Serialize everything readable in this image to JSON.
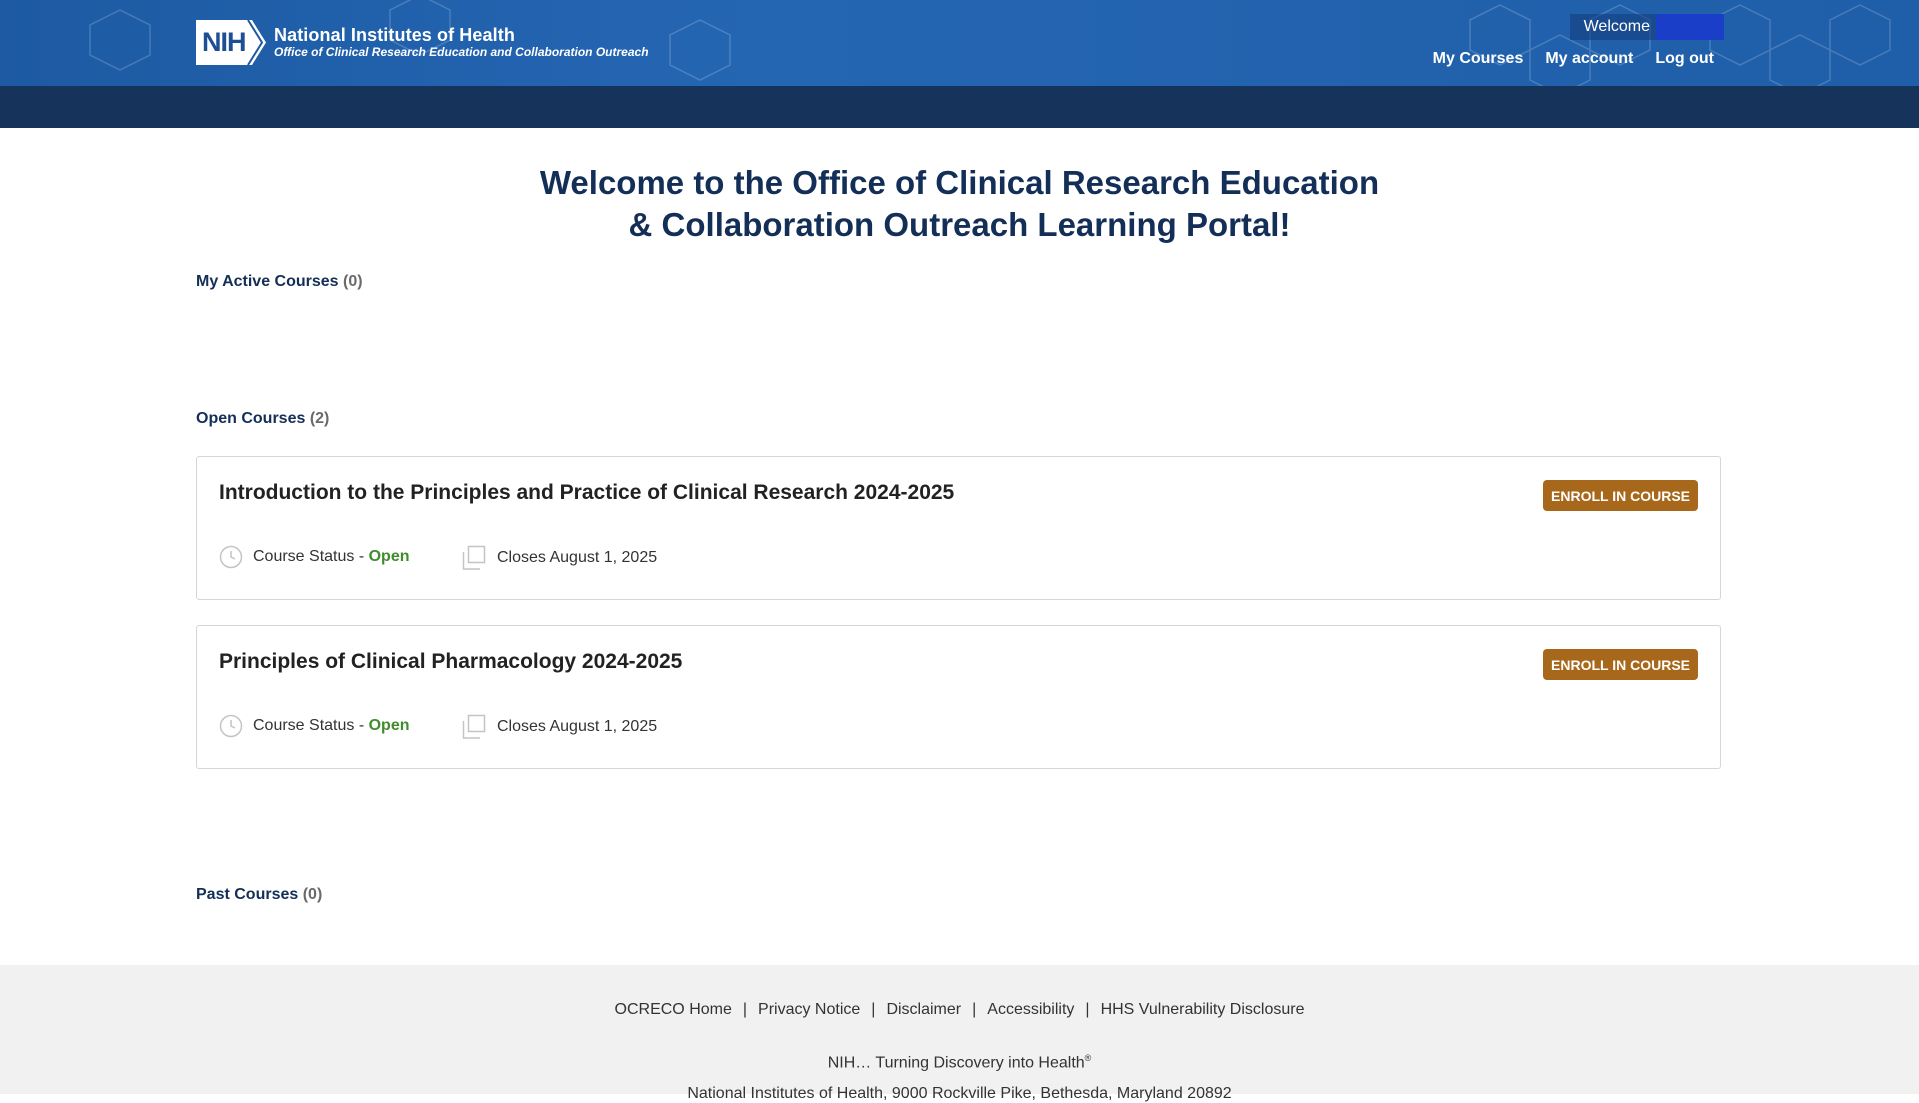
{
  "header": {
    "logo_abbr": "NIH",
    "logo_title": "National Institutes of Health",
    "logo_subtitle": "Office of Clinical Research Education and Collaboration Outreach",
    "welcome_label": "Welcome",
    "nav": [
      "My Courses",
      "My account",
      "Log out"
    ]
  },
  "main": {
    "title_line1": "Welcome to the Office of Clinical Research Education",
    "title_line2": "& Collaboration Outreach Learning Portal!",
    "active_label": "My Active Courses",
    "active_count": "(0)",
    "open_label": "Open Courses",
    "open_count": "(2)",
    "past_label": "Past Courses",
    "past_count": "(0)",
    "courses": [
      {
        "title": "Introduction to the Principles and Practice of Clinical Research 2024-2025",
        "button": "ENROLL IN COURSE",
        "status_prefix": "Course Status - ",
        "status": "Open",
        "closes": "Closes August 1, 2025"
      },
      {
        "title": "Principles of Clinical Pharmacology 2024-2025",
        "button": "ENROLL IN COURSE",
        "status_prefix": "Course Status - ",
        "status": "Open",
        "closes": "Closes August 1, 2025"
      }
    ]
  },
  "footer": {
    "links": [
      "OCRECO Home",
      "Privacy Notice",
      "Disclaimer",
      "Accessibility",
      "HHS Vulnerability Disclosure"
    ],
    "separator": "|",
    "tagline": "NIH… Turning Discovery into Health",
    "tagline_mark": "®",
    "address": "National Institutes of Health, 9000 Rockville Pike, Bethesda, Maryland 20892"
  },
  "colors": {
    "header_blue": "#2566b3",
    "subbar_navy": "#15335b",
    "title_navy": "#142f57",
    "enroll_brown": "#a8681b",
    "status_green": "#3f8c2d"
  }
}
